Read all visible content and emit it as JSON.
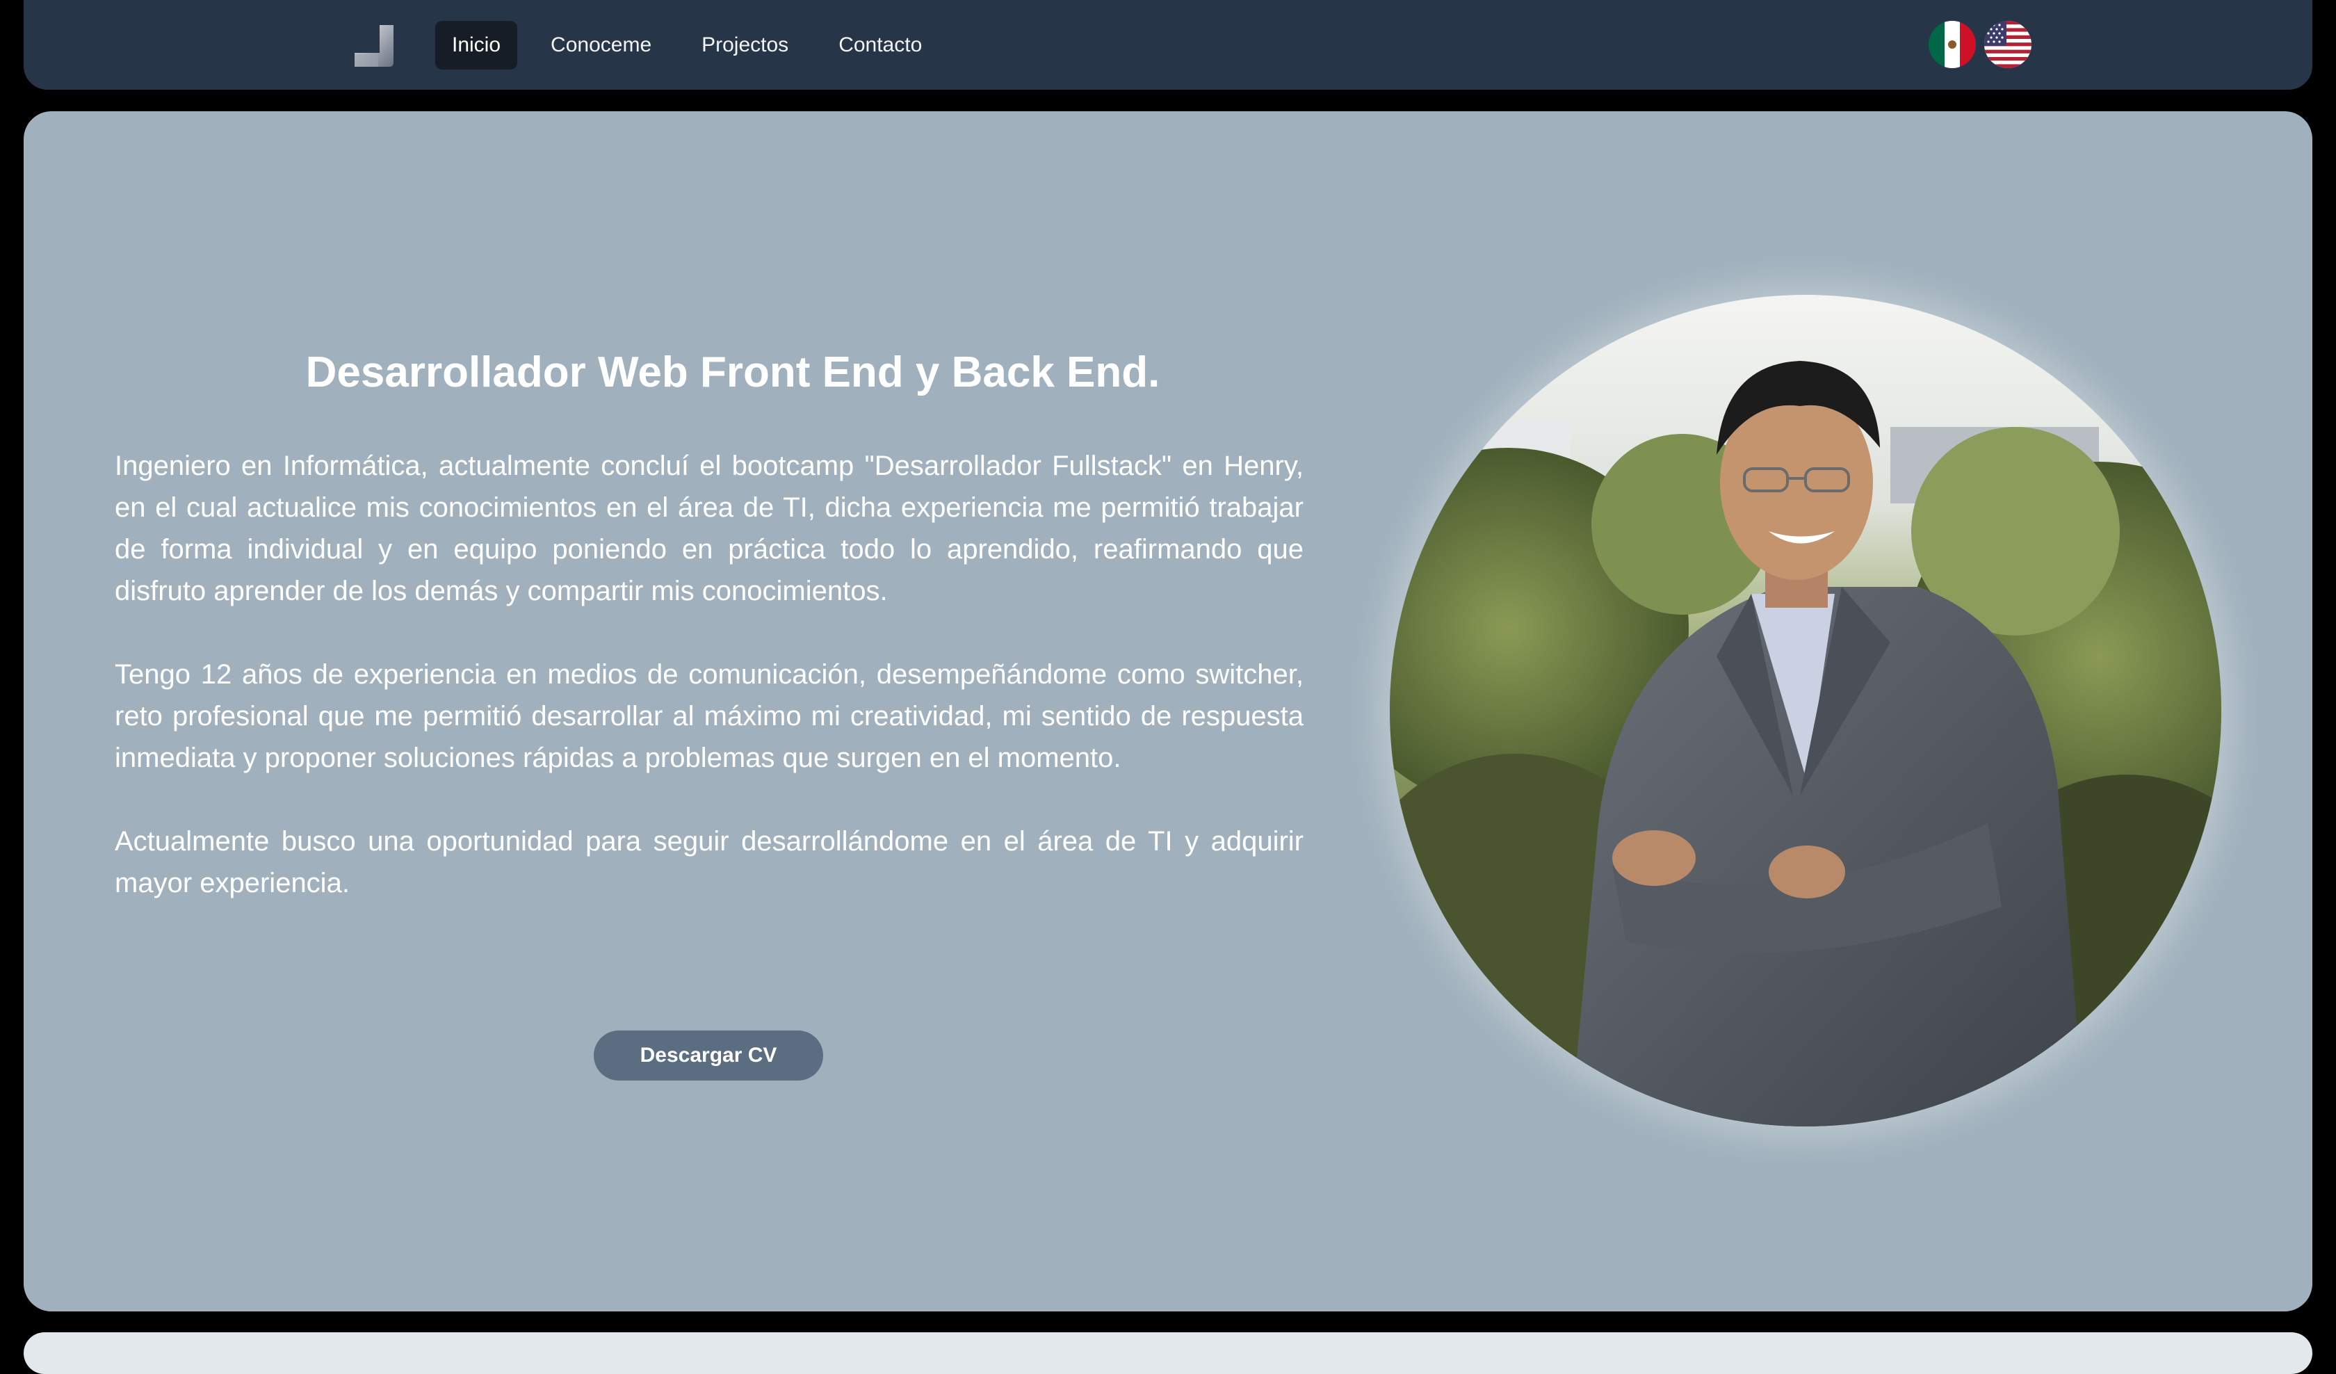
{
  "nav": {
    "logo_icon": "logo-mark-icon",
    "links": [
      {
        "label": "Inicio",
        "active": true
      },
      {
        "label": "Conoceme",
        "active": false
      },
      {
        "label": "Projectos",
        "active": false
      },
      {
        "label": "Contacto",
        "active": false
      }
    ],
    "languages": [
      {
        "icon": "mexico-flag-icon"
      },
      {
        "icon": "usa-flag-icon"
      }
    ]
  },
  "hero": {
    "title": "Desarrollador Web Front End y Back End.",
    "paragraphs": [
      "Ingeniero en Informática, actualmente concluí el bootcamp \"Desarrollador Fullstack\" en Henry, en el cual actualice mis conocimientos en el área de TI, dicha experiencia me permitió trabajar de forma individual y en equipo poniendo en práctica todo lo aprendido, reafirmando que disfruto aprender de los demás y compartir mis conocimientos.",
      "Tengo 12 años de experiencia en medios de comunicación, desempeñándome como switcher, reto profesional que me permitió desarrollar al máximo mi creatividad, mi sentido de respuesta inmediata y proponer soluciones rápidas a problemas que surgen en el momento.",
      "Actualmente busco una oportunidad para seguir desarrollándome en el área de TI y adquirir mayor experiencia."
    ],
    "cv_button": "Descargar CV"
  },
  "colors": {
    "navbar": "#273548",
    "hero_bg": "#a0b1bd",
    "button": "#5b6d80",
    "page_bg": "#000000"
  }
}
